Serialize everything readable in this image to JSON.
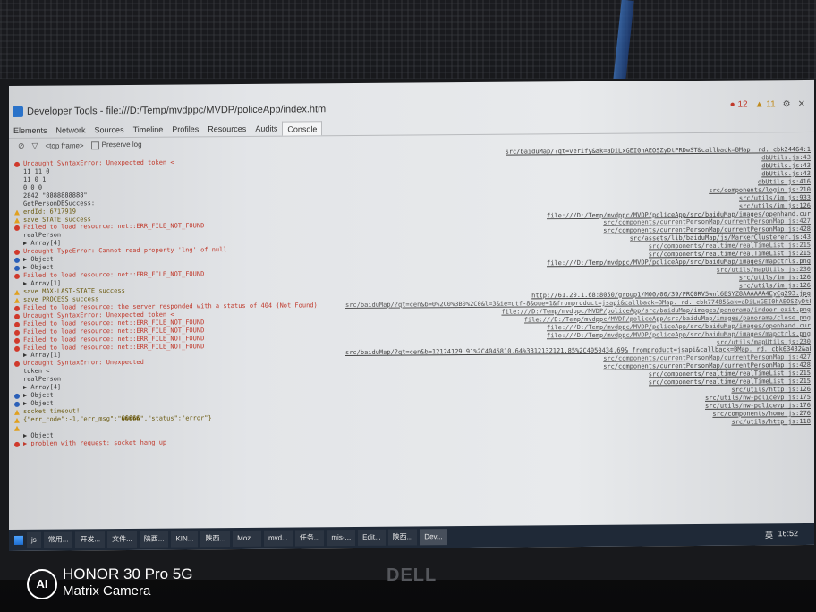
{
  "window": {
    "title": "Developer Tools - file:///D:/Temp/mvdppc/MVDP/policeApp/index.html",
    "error_count": "12",
    "warning_count": "11"
  },
  "tabs": [
    "Elements",
    "Network",
    "Sources",
    "Timeline",
    "Profiles",
    "Resources",
    "Audits",
    "Console"
  ],
  "toolbar": {
    "frame": "<top frame>",
    "preserve_log": "Preserve log"
  },
  "console": [
    {
      "level": "log",
      "msg": "",
      "src": "src/baiduMap/?qt=verify&ak=aDiLxGEI0hAEOSZyDtPRDwST&callback=BMap._rd._cbk24464:1"
    },
    {
      "level": "error",
      "msg": "Uncaught SyntaxError: Unexpected token <",
      "src": "dbUtils.js:43"
    },
    {
      "level": "log",
      "msg": "11 11 0",
      "src": "dbUtils.js:43"
    },
    {
      "level": "log",
      "msg": "11 0 1",
      "src": "dbUtils.js:43"
    },
    {
      "level": "log",
      "msg": "0 0 0",
      "src": "dbUtils.js:416"
    },
    {
      "level": "log",
      "msg": "2842 \"8888888888\"",
      "src": "src/components/login.js:210"
    },
    {
      "level": "log",
      "msg": "GetPersonDBSuccess:",
      "src": "src/utils/im.js:933"
    },
    {
      "level": "warn",
      "msg": "endId: 6717919",
      "src": "src/utils/im.js:126"
    },
    {
      "level": "warn",
      "msg": "save STATE success",
      "src": "file:///D:/Temp/mvdppc/MVDP/policeApp/src/baiduMap/images/openhand.cur"
    },
    {
      "level": "error",
      "msg": "Failed to load resource: net::ERR_FILE_NOT_FOUND",
      "src": "src/components/currentPersonMap/currentPersonMap.js:427"
    },
    {
      "level": "log",
      "msg": "realPerson",
      "src": "src/components/currentPersonMap/currentPersonMap.js:428"
    },
    {
      "level": "log",
      "msg": "▶ Array[4]",
      "src": "src/assets/lib/baiduMap/js/MarkerClusterer.js:43"
    },
    {
      "level": "error",
      "msg": "Uncaught TypeError: Cannot read property 'lng' of null",
      "src": "src/components/realtime/realTimeList.js:215"
    },
    {
      "level": "info",
      "msg": "▶ Object",
      "src": "src/components/realtime/realTimeList.js:215"
    },
    {
      "level": "info",
      "msg": "▶ Object",
      "src": "file:///D:/Temp/mvdppc/MVDP/policeApp/src/baiduMap/images/mapctrls.png"
    },
    {
      "level": "error",
      "msg": "Failed to load resource: net::ERR_FILE_NOT_FOUND",
      "src": "src/utils/mapUtils.js:230"
    },
    {
      "level": "log",
      "msg": "▶ Array[1]",
      "src": "src/utils/im.js:126"
    },
    {
      "level": "warn",
      "msg": "save MAX-LAST-STATE success",
      "src": "src/utils/im.js:126"
    },
    {
      "level": "warn",
      "msg": "save PROCESS success",
      "src": "http://61.20.1.68:8050/group1/M00/00/39/PRQ0RV5wnl6ESYZ8AAAAAA4EyCg293.jpg"
    },
    {
      "level": "error",
      "msg": "Failed to load resource: the server responded with a status of 404 (Not Found)",
      "src": "src/baiduMap/?qt=cen&b=0%2C0%3B0%2C0&l=3&ie=utf-8&oue=1&fromproduct=jsapi&callback=BMap._rd._cbk77485&ak=aDiLxGEI0hAEOSZyDtPRDwST:1"
    },
    {
      "level": "error",
      "msg": "Uncaught SyntaxError: Unexpected token <",
      "src": "file:///D:/Temp/mvdppc/MVDP/policeApp/src/baiduMap/images/panorama/indoor_exit.png"
    },
    {
      "level": "error",
      "msg": "Failed to load resource: net::ERR_FILE_NOT_FOUND",
      "src": "file:///D:/Temp/mvdppc/MVDP/policeApp/src/baiduMap/images/panorama/close.png"
    },
    {
      "level": "error",
      "msg": "Failed to load resource: net::ERR_FILE_NOT_FOUND",
      "src": "file:///D:/Temp/mvdppc/MVDP/policeApp/src/baiduMap/images/openhand.cur"
    },
    {
      "level": "error",
      "msg": "Failed to load resource: net::ERR_FILE_NOT_FOUND",
      "src": "file:///D:/Temp/mvdppc/MVDP/policeApp/src/baiduMap/images/mapctrls.png"
    },
    {
      "level": "error",
      "msg": "Failed to load resource: net::ERR_FILE_NOT_FOUND",
      "src": "src/utils/mapUtils.js:230"
    },
    {
      "level": "log",
      "msg": "▶ Array[1]",
      "src": "src/baiduMap/?qt=cen&b=12124129.91%2C4045810.64%3B12132121.85%2C4050434.69&_fromproduct=jsapi&callback=BMap._rd._cbk63432&ak=aDiLxGEI0hAEOSZyDtPRDwST:1"
    },
    {
      "level": "error",
      "msg": "Uncaught SyntaxError: Unexpected",
      "src": "src/components/currentPersonMap/currentPersonMap.js:427"
    },
    {
      "level": "log",
      "msg": "token <",
      "src": "src/components/currentPersonMap/currentPersonMap.js:428"
    },
    {
      "level": "log",
      "msg": "realPerson",
      "src": "src/components/realtime/realTimeList.js:215"
    },
    {
      "level": "log",
      "msg": "▶ Array[4]",
      "src": "src/components/realtime/realTimeList.js:215"
    },
    {
      "level": "info",
      "msg": "▶ Object",
      "src": "src/utils/http.js:126"
    },
    {
      "level": "info",
      "msg": "▶ Object",
      "src": "src/utils/nw-policevp.js:175"
    },
    {
      "level": "warn",
      "msg": "socket timeout!",
      "src": "src/utils/nw-policevp.js:176"
    },
    {
      "level": "warn",
      "msg": "{\"err_code\":-1,\"err_msg\":\"�����\",\"status\":\"error\"}",
      "src": "src/components/home.js:276"
    },
    {
      "level": "warn",
      "msg": "",
      "src": "src/utils/http.js:118"
    },
    {
      "level": "log",
      "msg": "▶ Object",
      "src": ""
    },
    {
      "level": "error",
      "msg": "▶ problem with request: socket hang up",
      "src": ""
    }
  ],
  "taskbar": {
    "items": [
      "js",
      "常用...",
      "开发...",
      "文件...",
      "陕西...",
      "KIN...",
      "陕西...",
      "Moz...",
      "mvd...",
      "任务...",
      "mis-...",
      "Edit...",
      "陕西...",
      "Dev..."
    ],
    "ime": "英",
    "clock": "16:52"
  },
  "monitor_brand": "DELL",
  "watermark": {
    "line1": "HONOR 30 Pro 5G",
    "line2": "Matrix Camera",
    "logo": "AI"
  }
}
